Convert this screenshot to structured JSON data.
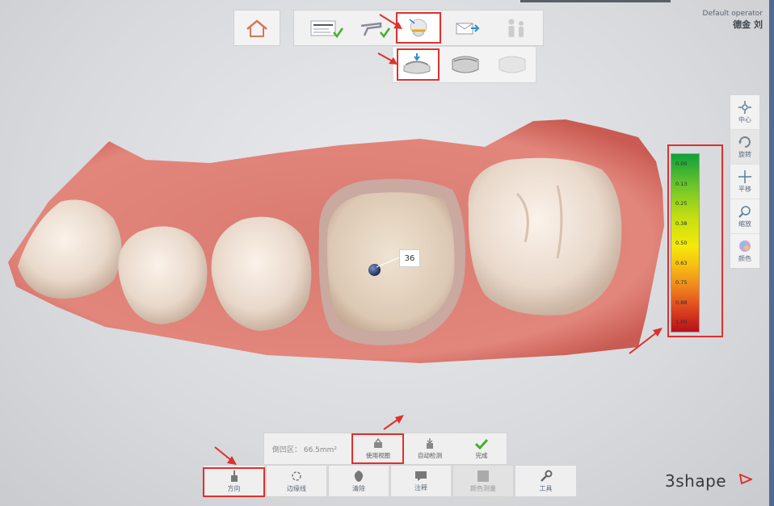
{
  "operator": {
    "label": "Default operator",
    "name": "德金 刘"
  },
  "side_tools": [
    {
      "label": "中心",
      "icon": "center-icon"
    },
    {
      "label": "旋转",
      "icon": "rotate-icon"
    },
    {
      "label": "平移",
      "icon": "pan-icon"
    },
    {
      "label": "缩放",
      "icon": "zoom-icon"
    },
    {
      "label": "颜色",
      "icon": "color-icon"
    }
  ],
  "color_scale": {
    "ticks": [
      "0.00",
      "0.13",
      "0.25",
      "0.38",
      "0.50",
      "0.63",
      "0.75",
      "0.88",
      "1.00"
    ],
    "colors": [
      "#0fa13a",
      "#c6df10",
      "#f6e80a",
      "#f08a1c",
      "#b8101a"
    ]
  },
  "tooth_number": "36",
  "bottom_upper": {
    "info": "倒凹区： 66.5mm²",
    "buttons": [
      {
        "label": "使用视图",
        "icon": "use-view-icon"
      },
      {
        "label": "自动检测",
        "icon": "auto-detect-icon"
      },
      {
        "label": "完成",
        "icon": "check-icon"
      }
    ]
  },
  "bottom_lower": {
    "buttons": [
      {
        "label": "方向",
        "icon": "direction-icon"
      },
      {
        "label": "边缘线",
        "icon": "margin-line-icon"
      },
      {
        "label": "清除",
        "icon": "clear-icon"
      },
      {
        "label": "注释",
        "icon": "annotation-icon"
      },
      {
        "label": "颜色测量",
        "icon": "shade-measure-icon"
      },
      {
        "label": "工具",
        "icon": "wrench-icon"
      }
    ]
  },
  "brand": {
    "name": "3shape"
  }
}
